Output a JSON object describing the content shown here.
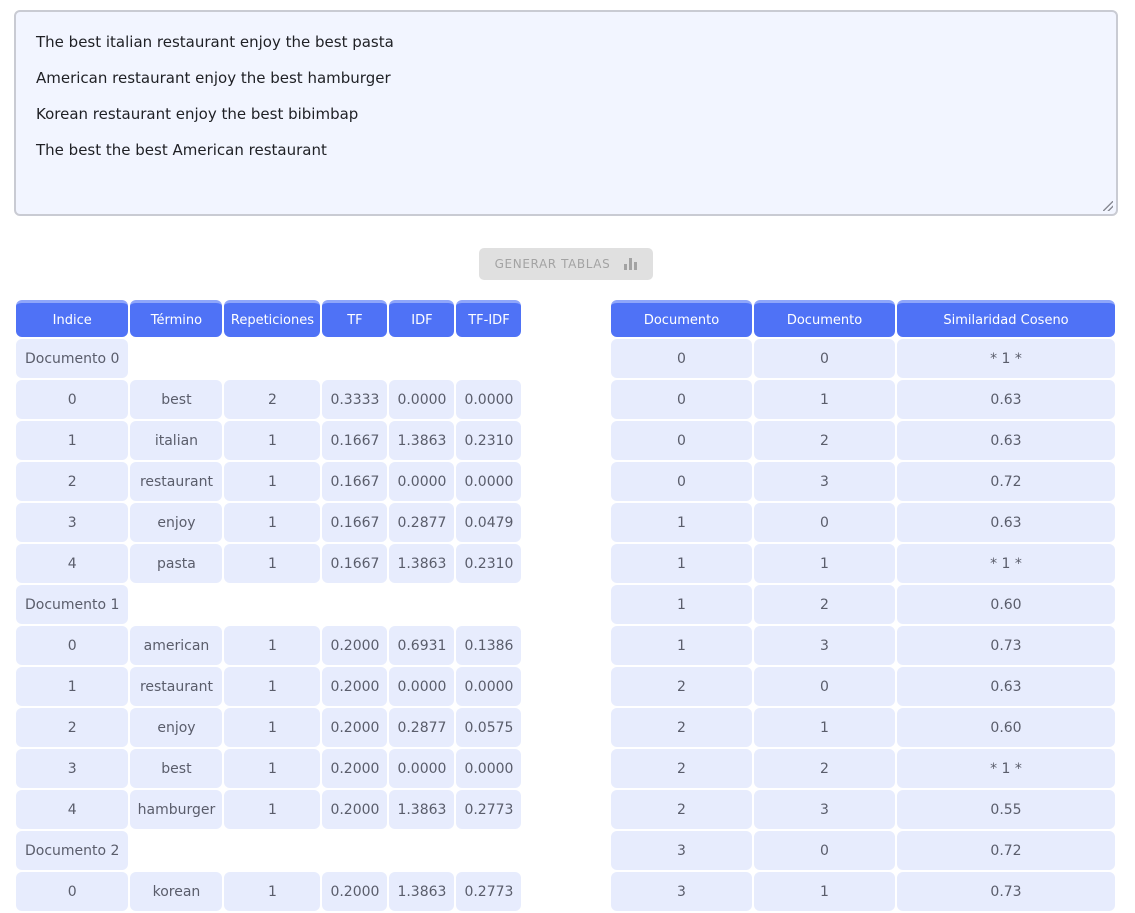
{
  "input_lines": [
    "The best italian restaurant enjoy the best pasta",
    "American restaurant enjoy the best hamburger",
    "Korean restaurant enjoy the best bibimbap",
    "The best the best American restaurant"
  ],
  "generate_button": {
    "label": "GENERAR TABLAS",
    "icon": "bar-chart-icon"
  },
  "tfidf_table": {
    "headers": [
      "Indice",
      "Término",
      "Repeticiones",
      "TF",
      "IDF",
      "TF-IDF"
    ],
    "groups": [
      {
        "label": "Documento 0",
        "rows": [
          [
            "0",
            "best",
            "2",
            "0.3333",
            "0.0000",
            "0.0000"
          ],
          [
            "1",
            "italian",
            "1",
            "0.1667",
            "1.3863",
            "0.2310"
          ],
          [
            "2",
            "restaurant",
            "1",
            "0.1667",
            "0.0000",
            "0.0000"
          ],
          [
            "3",
            "enjoy",
            "1",
            "0.1667",
            "0.2877",
            "0.0479"
          ],
          [
            "4",
            "pasta",
            "1",
            "0.1667",
            "1.3863",
            "0.2310"
          ]
        ]
      },
      {
        "label": "Documento 1",
        "rows": [
          [
            "0",
            "american",
            "1",
            "0.2000",
            "0.6931",
            "0.1386"
          ],
          [
            "1",
            "restaurant",
            "1",
            "0.2000",
            "0.0000",
            "0.0000"
          ],
          [
            "2",
            "enjoy",
            "1",
            "0.2000",
            "0.2877",
            "0.0575"
          ],
          [
            "3",
            "best",
            "1",
            "0.2000",
            "0.0000",
            "0.0000"
          ],
          [
            "4",
            "hamburger",
            "1",
            "0.2000",
            "1.3863",
            "0.2773"
          ]
        ]
      },
      {
        "label": "Documento 2",
        "rows": [
          [
            "0",
            "korean",
            "1",
            "0.2000",
            "1.3863",
            "0.2773"
          ]
        ]
      }
    ]
  },
  "similarity_table": {
    "headers": [
      "Documento",
      "Documento",
      "Similaridad Coseno"
    ],
    "rows": [
      [
        "0",
        "0",
        "* 1 *"
      ],
      [
        "0",
        "1",
        "0.63"
      ],
      [
        "0",
        "2",
        "0.63"
      ],
      [
        "0",
        "3",
        "0.72"
      ],
      [
        "1",
        "0",
        "0.63"
      ],
      [
        "1",
        "1",
        "* 1 *"
      ],
      [
        "1",
        "2",
        "0.60"
      ],
      [
        "1",
        "3",
        "0.73"
      ],
      [
        "2",
        "0",
        "0.63"
      ],
      [
        "2",
        "1",
        "0.60"
      ],
      [
        "2",
        "2",
        "* 1 *"
      ],
      [
        "2",
        "3",
        "0.55"
      ],
      [
        "3",
        "0",
        "0.72"
      ],
      [
        "3",
        "1",
        "0.73"
      ]
    ]
  }
}
